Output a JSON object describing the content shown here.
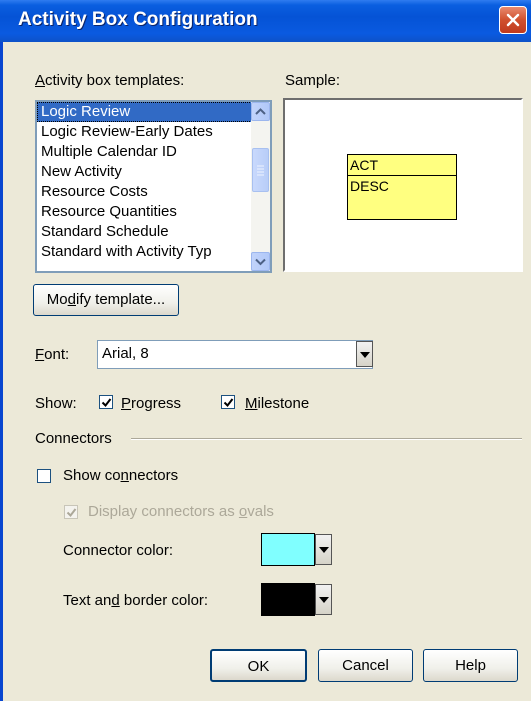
{
  "window": {
    "title": "Activity Box Configuration"
  },
  "templates": {
    "label": "Activity box templates:",
    "items": [
      "Logic Review",
      "Logic Review-Early Dates",
      "Multiple Calendar ID",
      "New Activity",
      "Resource Costs",
      "Resource Quantities",
      "Standard Schedule",
      "Standard with Activity Typ"
    ],
    "selected": "Logic Review"
  },
  "sample": {
    "label": "Sample:",
    "act": "ACT",
    "desc": "DESC",
    "box_color": "#ffff80"
  },
  "modify_button": "Modify template...",
  "font": {
    "label": "Font:",
    "value": "Arial, 8"
  },
  "show": {
    "label": "Show:",
    "progress": {
      "label": "Progress",
      "checked": true
    },
    "milestone": {
      "label": "Milestone",
      "checked": true
    }
  },
  "connectors": {
    "group_label": "Connectors",
    "show_connectors": {
      "label": "Show connectors",
      "checked": false
    },
    "display_ovals": {
      "label": "Display connectors as ovals",
      "checked": true,
      "disabled": true
    },
    "connector_color": {
      "label": "Connector color:",
      "color": "#80ffff"
    },
    "text_border_color": {
      "label": "Text and border color:",
      "color": "#000000"
    }
  },
  "buttons": {
    "ok": "OK",
    "cancel": "Cancel",
    "help": "Help"
  }
}
